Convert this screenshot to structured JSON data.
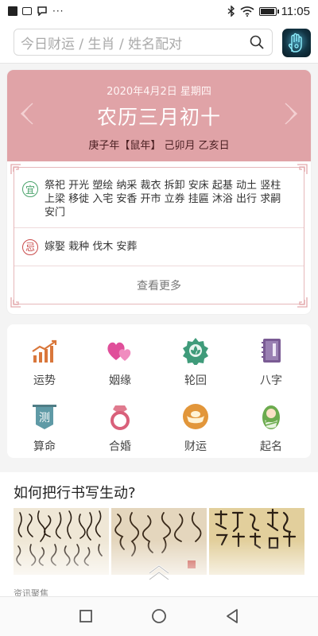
{
  "status_bar": {
    "time": "11:05",
    "dots": "···",
    "battery_level": 0.95
  },
  "search": {
    "placeholder": "今日财运 / 生肖 / 姓名配对"
  },
  "almanac": {
    "date": "2020年4月2日 星期四",
    "lunar": "农历三月初十",
    "ganzhi": "庚子年【鼠年】 己卯月 乙亥日",
    "yi_badge": "宜",
    "yi_text": "祭祀 开光 塑绘 纳采 裁衣 拆卸 安床 起基 动土 竖柱 上梁 移徙 入宅 安香 开市 立券 挂匾 沐浴 出行 求嗣 安门",
    "ji_badge": "忌",
    "ji_text": "嫁娶 栽种 伐木 安葬",
    "more_label": "查看更多"
  },
  "tools": [
    {
      "label": "运势",
      "icon": "trend-chart-icon"
    },
    {
      "label": "姻缘",
      "icon": "hearts-icon"
    },
    {
      "label": "轮回",
      "icon": "lotus-badge-icon"
    },
    {
      "label": "八字",
      "icon": "book-icon"
    },
    {
      "label": "算命",
      "icon": "banner-icon",
      "glyph": "测"
    },
    {
      "label": "合婚",
      "icon": "ring-icon"
    },
    {
      "label": "财运",
      "icon": "gold-ingot-icon"
    },
    {
      "label": "起名",
      "icon": "baby-icon"
    }
  ],
  "article": {
    "title": "如何把行书写生动?",
    "source": "资讯聚焦"
  },
  "colors": {
    "almanac_header": "#e0a3a7",
    "yi": "#4aa36b",
    "ji": "#c94b4b",
    "accent_orange": "#d9773b",
    "accent_purple": "#7a5b94"
  }
}
